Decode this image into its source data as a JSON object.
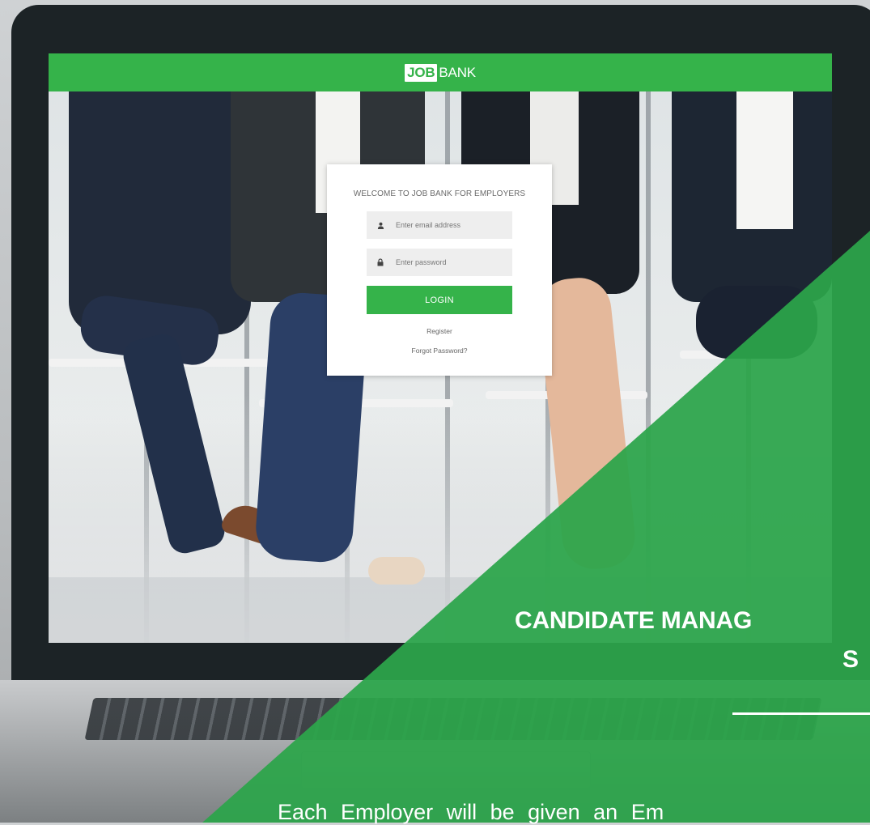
{
  "app": {
    "logo_job": "JOB",
    "logo_bank": "BANK"
  },
  "login": {
    "welcome": "WELCOME TO JOB BANK FOR EMPLOYERS",
    "email_placeholder": "Enter email address",
    "password_placeholder": "Enter password",
    "login_label": "LOGIN",
    "register_label": "Register",
    "forgot_label": "Forgot Password?"
  },
  "slide": {
    "title_line1": "CANDIDATE MANAG",
    "title_line2": "S",
    "body": "Each Employer will be given an Em"
  },
  "colors": {
    "brand_green": "#35b34a",
    "overlay_green": "#2fa94e",
    "bezel": "#1c2326"
  },
  "icons": {
    "email": "user-icon",
    "password": "lock-icon"
  }
}
